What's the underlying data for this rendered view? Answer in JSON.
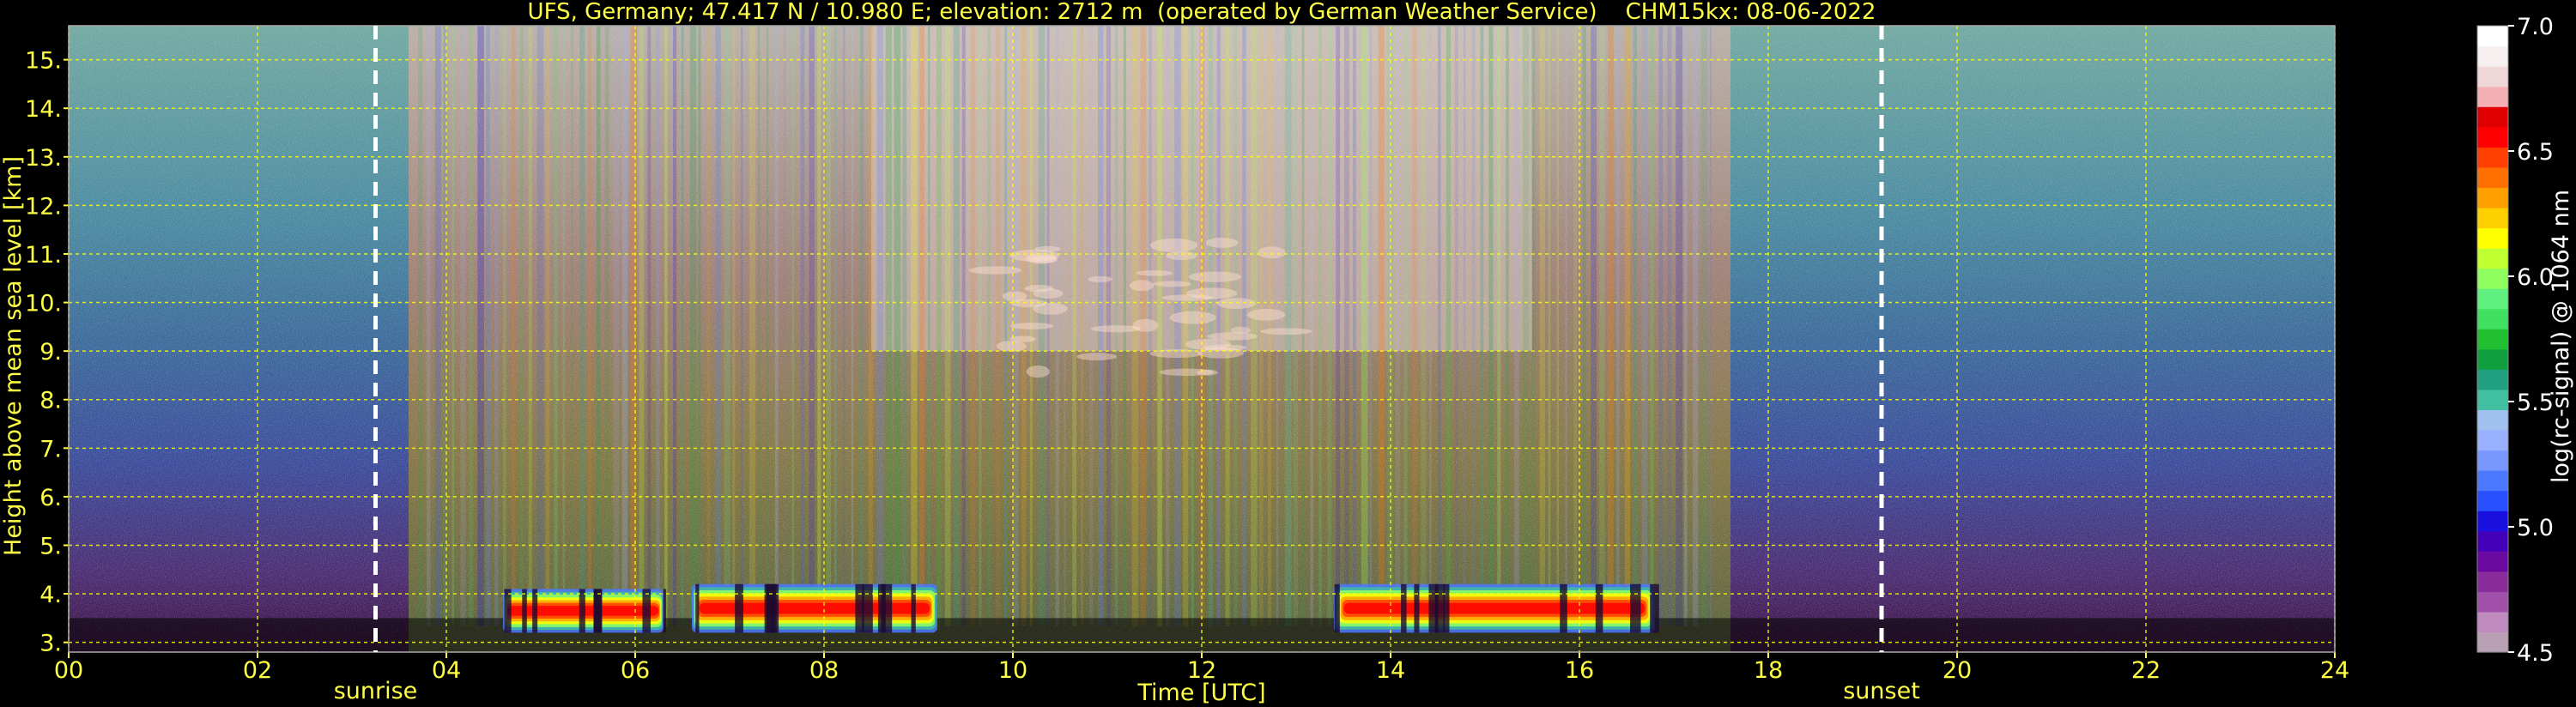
{
  "chart_data": {
    "type": "heatmap",
    "title": "UFS, Germany; 47.417 N / 10.980 E; elevation: 2712 m  (operated by German Weather Service)    CHM15kx: 08-06-2022",
    "xlabel": "Time [UTC]",
    "ylabel": "Height above mean sea level [km]",
    "xlim": [
      0,
      24
    ],
    "ylim": [
      2.8,
      15.7
    ],
    "x_ticks": [
      "00",
      "02",
      "04",
      "06",
      "08",
      "10",
      "12",
      "14",
      "16",
      "18",
      "20",
      "22",
      "24"
    ],
    "y_ticks": [
      "3.",
      "4.",
      "5.",
      "6.",
      "7.",
      "8.",
      "9.",
      "10.",
      "11.",
      "12.",
      "13.",
      "14.",
      "15."
    ],
    "grid": true,
    "grid_color": "#ffff00",
    "colorbar": {
      "label": "log(rc-signal) @ 1064 nm",
      "min": 4.5,
      "max": 7.0,
      "ticks": [
        "4.5",
        "5.0",
        "5.5",
        "6.0",
        "6.5",
        "7.0"
      ],
      "colors": [
        "#b9a0b4",
        "#c08cc0",
        "#a050a8",
        "#8a2c9c",
        "#6a0aa0",
        "#4400b8",
        "#1a10e0",
        "#2850ff",
        "#4c78ff",
        "#7898ff",
        "#98b0ff",
        "#a0c0f0",
        "#40c0a0",
        "#20a080",
        "#10a040",
        "#20c030",
        "#40e060",
        "#60f080",
        "#90ff60",
        "#c0ff30",
        "#ffff00",
        "#ffd000",
        "#ffa000",
        "#ff7000",
        "#ff4000",
        "#ff0000",
        "#e00000",
        "#f4b0b4",
        "#f0d8d8",
        "#f8f0f0",
        "#ffffff"
      ]
    },
    "annotations": [
      {
        "text": "sunrise",
        "time": 3.25
      },
      {
        "text": "sunset",
        "time": 19.2
      }
    ],
    "series": [
      {
        "name": "sunrise",
        "x": [
          3.25,
          3.25
        ],
        "y": [
          2.8,
          15.7
        ]
      },
      {
        "name": "sunset",
        "x": [
          19.2,
          19.2
        ],
        "y": [
          2.8,
          15.7
        ]
      }
    ],
    "cloud_features": [
      {
        "t_start": 4.6,
        "t_end": 6.3,
        "h_low": 3.2,
        "h_high": 4.1
      },
      {
        "t_start": 6.6,
        "t_end": 9.2,
        "h_low": 3.2,
        "h_high": 4.2
      },
      {
        "t_start": 13.4,
        "t_end": 16.8,
        "h_low": 3.2,
        "h_high": 4.2
      },
      {
        "t_start": 9.8,
        "t_end": 13.0,
        "h_low": 8.5,
        "h_high": 11.3
      }
    ]
  }
}
